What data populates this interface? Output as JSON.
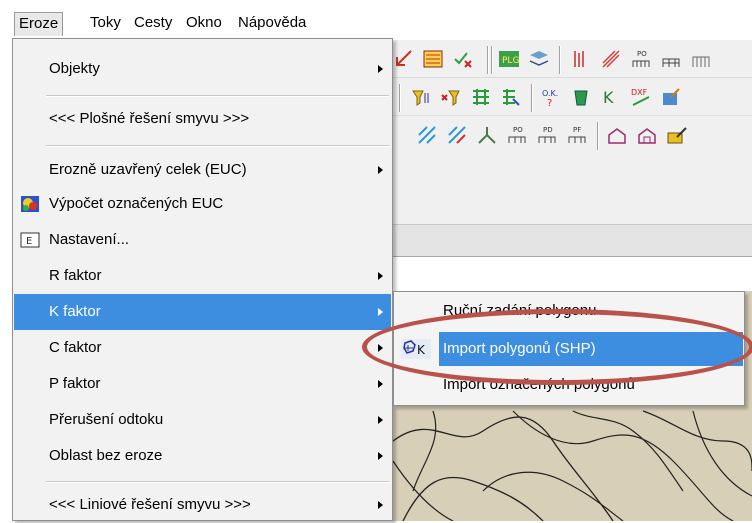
{
  "menubar": {
    "items": [
      "Eroze",
      "Toky",
      "Cesty",
      "Okno",
      "Nápověda"
    ],
    "active_index": 0
  },
  "eroze_menu": {
    "items": [
      {
        "label": "Objekty",
        "icon": "",
        "has_submenu": true
      },
      {
        "label": "<<< Plošné řešení smyvu >>>",
        "icon": "",
        "has_submenu": false
      },
      {
        "label": "Erozně uzavřený celek (EUC)",
        "icon": "",
        "has_submenu": true
      },
      {
        "label": "Výpočet označených EUC",
        "icon": "euc-calculation-icon",
        "has_submenu": false
      },
      {
        "label": "Nastavení...",
        "icon": "settings-e-icon",
        "has_submenu": false
      },
      {
        "label": "R faktor",
        "icon": "",
        "has_submenu": true
      },
      {
        "label": "K faktor",
        "icon": "",
        "has_submenu": true,
        "highlighted": true
      },
      {
        "label": "C faktor",
        "icon": "",
        "has_submenu": true
      },
      {
        "label": "P faktor",
        "icon": "",
        "has_submenu": true
      },
      {
        "label": "Přerušení odtoku",
        "icon": "",
        "has_submenu": true
      },
      {
        "label": "Oblast bez eroze",
        "icon": "",
        "has_submenu": true
      },
      {
        "label": "<<< Liniové řešení smyvu >>>",
        "icon": "",
        "has_submenu": true
      }
    ]
  },
  "k_faktor_submenu": {
    "items": [
      {
        "label": "Ruční zadání polygonu",
        "icon": ""
      },
      {
        "label": "Import polygonů (SHP)",
        "icon": "import-polygon-icon",
        "highlighted": true
      },
      {
        "label": "Import označených polygonů",
        "icon": ""
      }
    ]
  },
  "colors": {
    "highlight": "#3d8ee0",
    "annotation": "#b8524a",
    "menu_background": "#f2f2f2"
  }
}
